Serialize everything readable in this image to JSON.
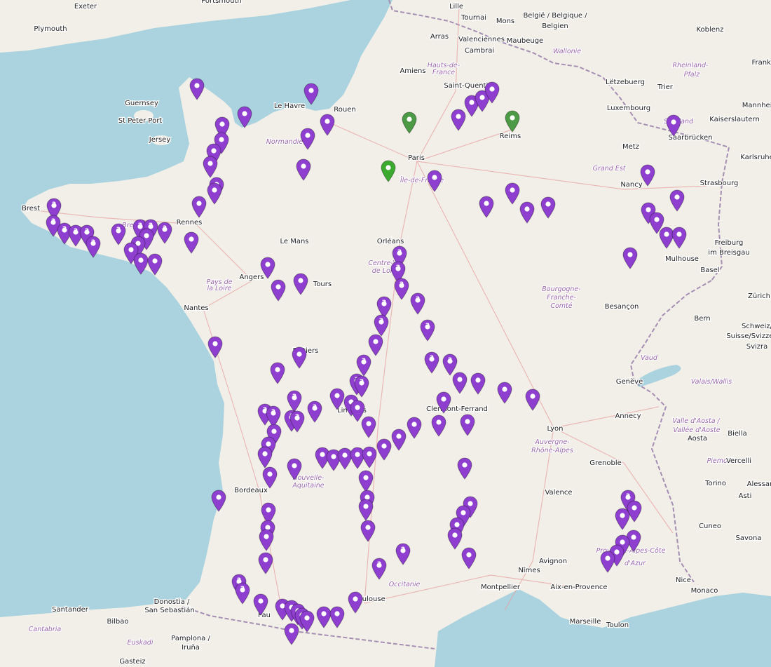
{
  "colors": {
    "sea": "#aad3df",
    "land": "#f2efe9",
    "border": "#a58fb2",
    "marker_default": "#8f3fd0",
    "marker_dark_green": "#4c9a45",
    "marker_light_green": "#3caa2f",
    "region_label": "#9a66a8",
    "city_label": "#222222"
  },
  "map_labels": {
    "cities": [
      {
        "id": "lille",
        "text": "Lille"
      },
      {
        "id": "tournai",
        "text": "Tournai"
      },
      {
        "id": "mons",
        "text": "Mons"
      },
      {
        "id": "arras",
        "text": "Arras"
      },
      {
        "id": "valenciennes",
        "text": "Valenciennes"
      },
      {
        "id": "maubeuge",
        "text": "Maubeuge"
      },
      {
        "id": "cambrai",
        "text": "Cambrai"
      },
      {
        "id": "amiens",
        "text": "Amiens"
      },
      {
        "id": "saint_quentin",
        "text": "Saint-Quentin"
      },
      {
        "id": "le_havre",
        "text": "Le Havre"
      },
      {
        "id": "rouen",
        "text": "Rouen"
      },
      {
        "id": "reims",
        "text": "Reims"
      },
      {
        "id": "paris",
        "text": "Paris"
      },
      {
        "id": "exeter",
        "text": "Exeter"
      },
      {
        "id": "portsmouth",
        "text": "Portsmouth"
      },
      {
        "id": "plymouth",
        "text": "Plymouth"
      },
      {
        "id": "guernsey",
        "text": "Guernsey"
      },
      {
        "id": "st_peter_port",
        "text": "St Peter Port"
      },
      {
        "id": "jersey",
        "text": "Jersey"
      },
      {
        "id": "brest",
        "text": "Brest"
      },
      {
        "id": "rennes",
        "text": "Rennes"
      },
      {
        "id": "le_mans",
        "text": "Le Mans"
      },
      {
        "id": "orleans",
        "text": "Orléans"
      },
      {
        "id": "angers",
        "text": "Angers"
      },
      {
        "id": "tours",
        "text": "Tours"
      },
      {
        "id": "nantes",
        "text": "Nantes"
      },
      {
        "id": "poitiers",
        "text": "Poitiers"
      },
      {
        "id": "limoges",
        "text": "Limoges"
      },
      {
        "id": "clermont",
        "text": "Clermont-Ferrand"
      },
      {
        "id": "lyon",
        "text": "Lyon"
      },
      {
        "id": "bordeaux",
        "text": "Bordeaux"
      },
      {
        "id": "toulouse",
        "text": "Toulouse"
      },
      {
        "id": "montpellier",
        "text": "Montpellier"
      },
      {
        "id": "nimes",
        "text": "Nîmes"
      },
      {
        "id": "avignon",
        "text": "Avignon"
      },
      {
        "id": "aix",
        "text": "Aix-en-Provence"
      },
      {
        "id": "marseille",
        "text": "Marseille"
      },
      {
        "id": "toulon",
        "text": "Toulon"
      },
      {
        "id": "monaco",
        "text": "Monaco"
      },
      {
        "id": "nice",
        "text": "Nice"
      },
      {
        "id": "grenoble",
        "text": "Grenoble"
      },
      {
        "id": "valence",
        "text": "Valence"
      },
      {
        "id": "annecy",
        "text": "Annecy"
      },
      {
        "id": "geneve",
        "text": "Genève"
      },
      {
        "id": "besancon",
        "text": "Besançon"
      },
      {
        "id": "nancy",
        "text": "Nancy"
      },
      {
        "id": "metz",
        "text": "Metz"
      },
      {
        "id": "strasbourg",
        "text": "Strasbourg"
      },
      {
        "id": "mulhouse",
        "text": "Mulhouse"
      },
      {
        "id": "basel",
        "text": "Basel"
      },
      {
        "id": "bern",
        "text": "Bern"
      },
      {
        "id": "zurich",
        "text": "Zürich"
      },
      {
        "id": "luxembourg",
        "text": "Luxembourg"
      },
      {
        "id": "letzebuerg",
        "text": "Lëtzebuerg"
      },
      {
        "id": "trier",
        "text": "Trier"
      },
      {
        "id": "saarbrucken",
        "text": "Saarbrücken"
      },
      {
        "id": "kaiserslautern",
        "text": "Kaiserslautern"
      },
      {
        "id": "mannheim",
        "text": "Mannheim"
      },
      {
        "id": "karlsruhe",
        "text": "Karlsruhe"
      },
      {
        "id": "freiburg1",
        "text": "Freiburg"
      },
      {
        "id": "freiburg2",
        "text": "im Breisgau"
      },
      {
        "id": "koblenz",
        "text": "Koblenz"
      },
      {
        "id": "frankfurt",
        "text": "Frankf"
      },
      {
        "id": "belgie1",
        "text": "België / Belgique /"
      },
      {
        "id": "belgie2",
        "text": "Belgien"
      },
      {
        "id": "torino",
        "text": "Torino"
      },
      {
        "id": "cuneo",
        "text": "Cuneo"
      },
      {
        "id": "savona",
        "text": "Savona"
      },
      {
        "id": "asti",
        "text": "Asti"
      },
      {
        "id": "alessandria",
        "text": "Alessan"
      },
      {
        "id": "biella",
        "text": "Biella"
      },
      {
        "id": "vercelli",
        "text": "Vercelli"
      },
      {
        "id": "aosta",
        "text": "Aosta"
      },
      {
        "id": "santander",
        "text": "Santander"
      },
      {
        "id": "bilbao",
        "text": "Bilbao"
      },
      {
        "id": "donostia1",
        "text": "Donostia /"
      },
      {
        "id": "donostia2",
        "text": "San Sebastián"
      },
      {
        "id": "pamplona1",
        "text": "Pamplona /"
      },
      {
        "id": "pamplona2",
        "text": "Iruña"
      },
      {
        "id": "gasteiz",
        "text": "Gasteiz"
      },
      {
        "id": "pau",
        "text": "Pau"
      },
      {
        "id": "schweiz1",
        "text": "Schweiz/"
      },
      {
        "id": "schweiz2",
        "text": "Suisse/Svizzera"
      },
      {
        "id": "schweiz3",
        "text": "Svizra"
      }
    ],
    "regions": [
      {
        "id": "hauts1",
        "text": "Hauts-de-"
      },
      {
        "id": "hauts2",
        "text": "France"
      },
      {
        "id": "wallonie",
        "text": "Wallonie"
      },
      {
        "id": "normandie",
        "text": "Normandie"
      },
      {
        "id": "idf",
        "text": "Île-de-France"
      },
      {
        "id": "grand_est",
        "text": "Grand Est"
      },
      {
        "id": "bretagne",
        "text": "Bretagne"
      },
      {
        "id": "pdl1",
        "text": "Pays de"
      },
      {
        "id": "pdl2",
        "text": "la Loire"
      },
      {
        "id": "cvl1",
        "text": "Centre-Val"
      },
      {
        "id": "cvl2",
        "text": "de Loire"
      },
      {
        "id": "bfc1",
        "text": "Bourgogne-"
      },
      {
        "id": "bfc2",
        "text": "Franche-"
      },
      {
        "id": "bfc3",
        "text": "Comté"
      },
      {
        "id": "na1",
        "text": "Nouvelle-"
      },
      {
        "id": "na2",
        "text": "Aquitaine"
      },
      {
        "id": "ara1",
        "text": "Auvergne-"
      },
      {
        "id": "ara2",
        "text": "Rhône-Alpes"
      },
      {
        "id": "occitanie",
        "text": "Occitanie"
      },
      {
        "id": "paca1",
        "text": "Provence-Alpes-Côte"
      },
      {
        "id": "paca2",
        "text": "d'Azur"
      },
      {
        "id": "rheinland1",
        "text": "Rheinland-"
      },
      {
        "id": "rheinland2",
        "text": "Pfalz"
      },
      {
        "id": "saarland",
        "text": "Saarland"
      },
      {
        "id": "vaud",
        "text": "Vaud"
      },
      {
        "id": "valais",
        "text": "Valais/Wallis"
      },
      {
        "id": "vda1",
        "text": "Valle d'Aosta /"
      },
      {
        "id": "vda2",
        "text": "Vallée d'Aoste"
      },
      {
        "id": "piemonte",
        "text": "Piemonte"
      },
      {
        "id": "euskadi",
        "text": "Euskadi"
      },
      {
        "id": "cantabria",
        "text": "Cantabria"
      }
    ]
  },
  "marker_counts": {
    "m_brest_a": "2",
    "m_brest_b": "2",
    "m_bz_1": "2",
    "m_bz_2": "2",
    "m_bz_3": "2",
    "m_bz_4": "2",
    "m_bz_5": "2",
    "m_bz_6": "2",
    "m_bz_7": "2",
    "m_bz_8": "2",
    "m_cot_1": "2",
    "m_cot_2": "2",
    "m_orl_1": "2",
    "m_orl_2": "2",
    "m_c_1": "2",
    "m_c_2": "2",
    "m_c_3": "2",
    "m_lim_1": "2",
    "m_lim_2": "2",
    "m_lim_3": "2",
    "m_ly_1": "2",
    "m_ly_2": "2",
    "m_sw_1": "2",
    "m_sw_2": "2",
    "m_sw_3": "2",
    "m_sw_4": "2",
    "m_sw_5": "2",
    "m_sw_6": "2",
    "m_tl_1": "2",
    "m_tl_2": "2",
    "m_pyr_1": "2",
    "m_pyr_2": "2",
    "m_paca_1": "2"
  }
}
